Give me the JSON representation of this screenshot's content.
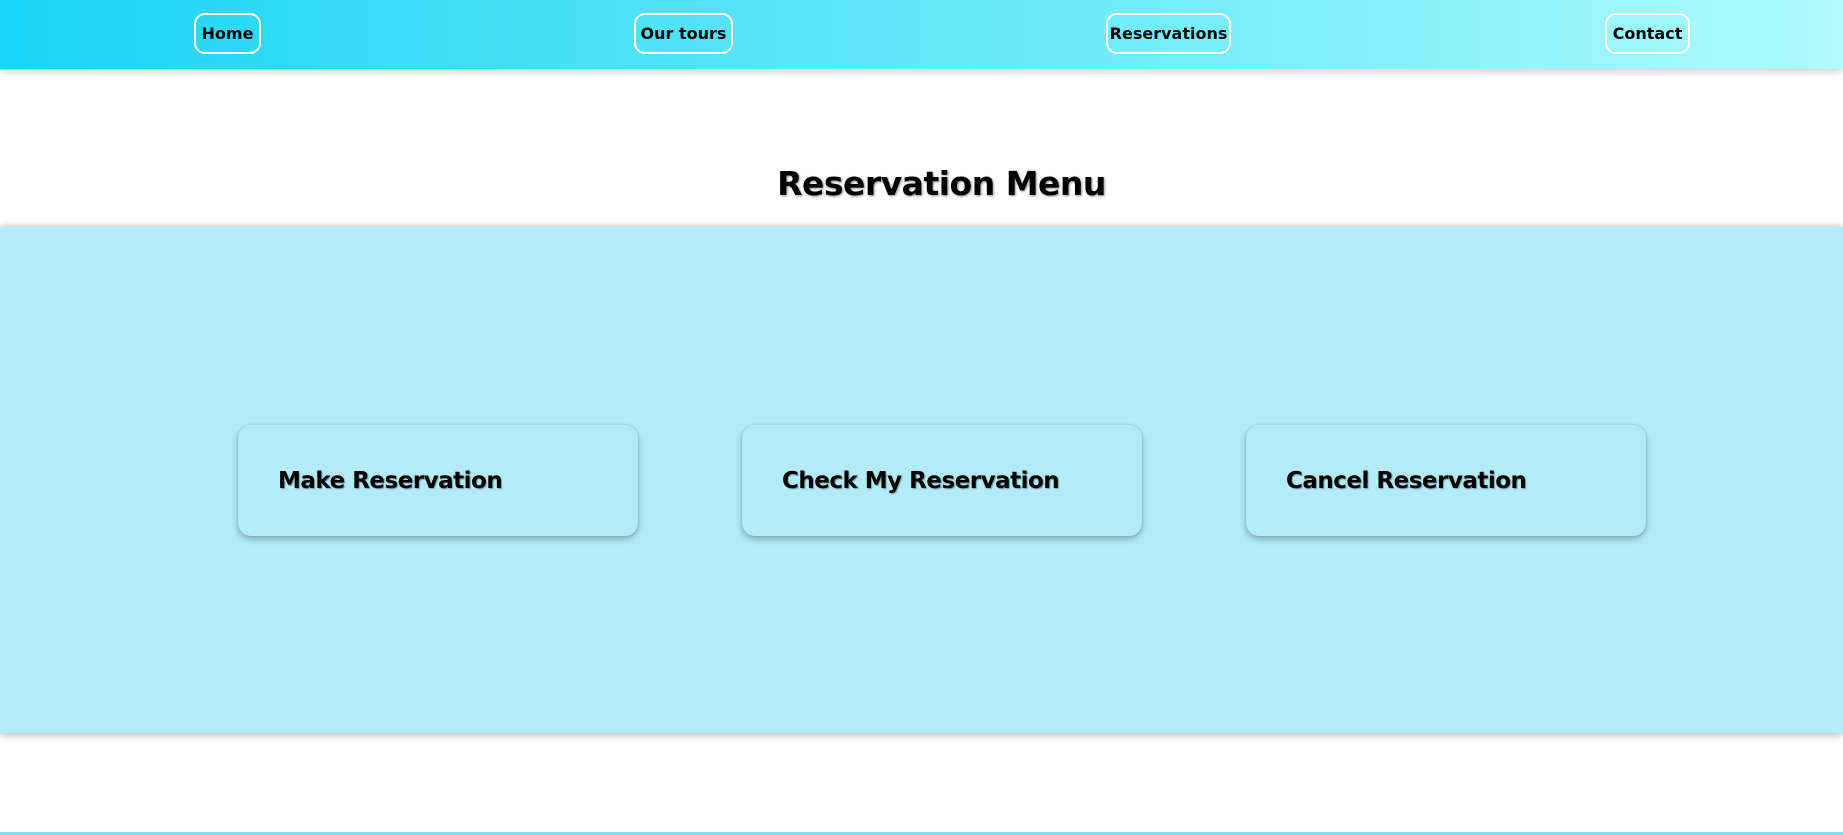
{
  "nav": {
    "items": [
      {
        "label": "Home"
      },
      {
        "label": "Our tours"
      },
      {
        "label": "Reservations"
      },
      {
        "label": "Contact"
      }
    ]
  },
  "main": {
    "title": "Reservation Menu",
    "cards": [
      {
        "label": "Make Reservation"
      },
      {
        "label": "Check My Reservation"
      },
      {
        "label": "Cancel Reservation"
      }
    ]
  },
  "colors": {
    "nav_gradient_start": "#19d4f5",
    "nav_gradient_end": "#b0fafb",
    "section_bg": "#b3ebf7",
    "page_bg": "#ffffff"
  }
}
